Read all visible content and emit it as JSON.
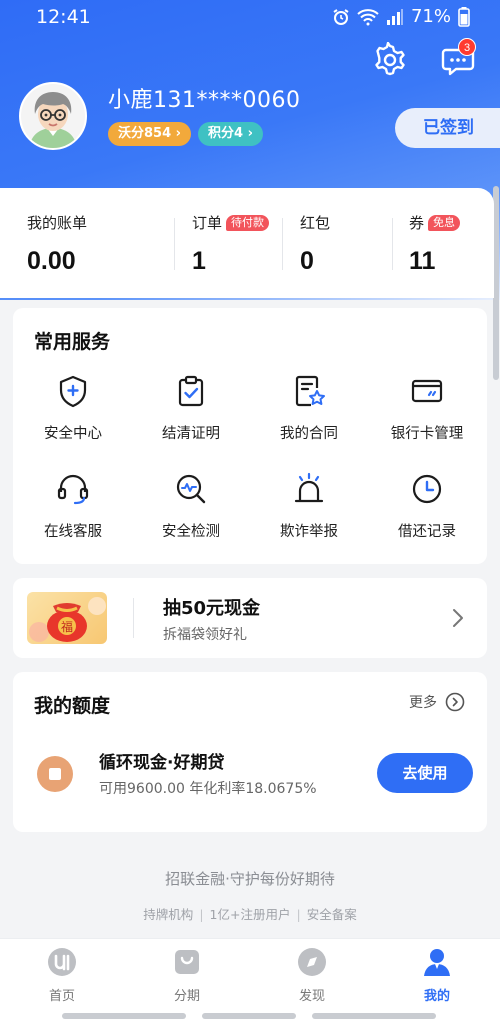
{
  "status_bar": {
    "time": "12:41",
    "battery": "71%",
    "icons": [
      "alarm-icon",
      "wifi-icon",
      "signal-icon",
      "battery-icon"
    ]
  },
  "header": {
    "username": "小鹿131****0060",
    "wo_points": "沃分854 ›",
    "ji_points": "积分4 ›",
    "signin_label": "已签到",
    "message_badge": "3"
  },
  "account": {
    "items": [
      {
        "label": "我的账单",
        "value": "0.00",
        "badge": ""
      },
      {
        "label": "订单",
        "value": "1",
        "badge": "待付款"
      },
      {
        "label": "红包",
        "value": "0",
        "badge": ""
      },
      {
        "label": "券",
        "value": "11",
        "badge": "免息"
      }
    ]
  },
  "services": {
    "title": "常用服务",
    "items": [
      {
        "label": "安全中心",
        "icon": "shield-plus-icon"
      },
      {
        "label": "结清证明",
        "icon": "clipboard-check-icon"
      },
      {
        "label": "我的合同",
        "icon": "contract-star-icon"
      },
      {
        "label": "银行卡管理",
        "icon": "bank-card-icon"
      },
      {
        "label": "在线客服",
        "icon": "headset-icon"
      },
      {
        "label": "安全检测",
        "icon": "scan-pulse-icon"
      },
      {
        "label": "欺诈举报",
        "icon": "alarm-light-icon"
      },
      {
        "label": "借还记录",
        "icon": "clock-icon"
      }
    ]
  },
  "promo": {
    "title": "抽50元现金",
    "subtitle": "拆福袋领好礼",
    "image_text": "福"
  },
  "quota": {
    "title": "我的额度",
    "more_label": "更多",
    "product_title": "循环现金·好期贷",
    "product_sub": "可用9600.00 年化利率18.0675%",
    "use_label": "去使用"
  },
  "footer": {
    "slogan": "招联金融·守护每份好期待",
    "links": [
      "持牌机构",
      "1亿+注册用户",
      "安全备案"
    ]
  },
  "tabbar": {
    "items": [
      {
        "label": "首页",
        "icon": "home-logo-icon"
      },
      {
        "label": "分期",
        "icon": "bag-icon"
      },
      {
        "label": "发现",
        "icon": "compass-icon"
      },
      {
        "label": "我的",
        "icon": "user-icon"
      }
    ],
    "active": "我的"
  },
  "colors": {
    "primary": "#2f6ef5",
    "badge_red": "#f2545b",
    "wo_orange": "#f2a93b",
    "ji_teal": "#3fc1c3"
  }
}
